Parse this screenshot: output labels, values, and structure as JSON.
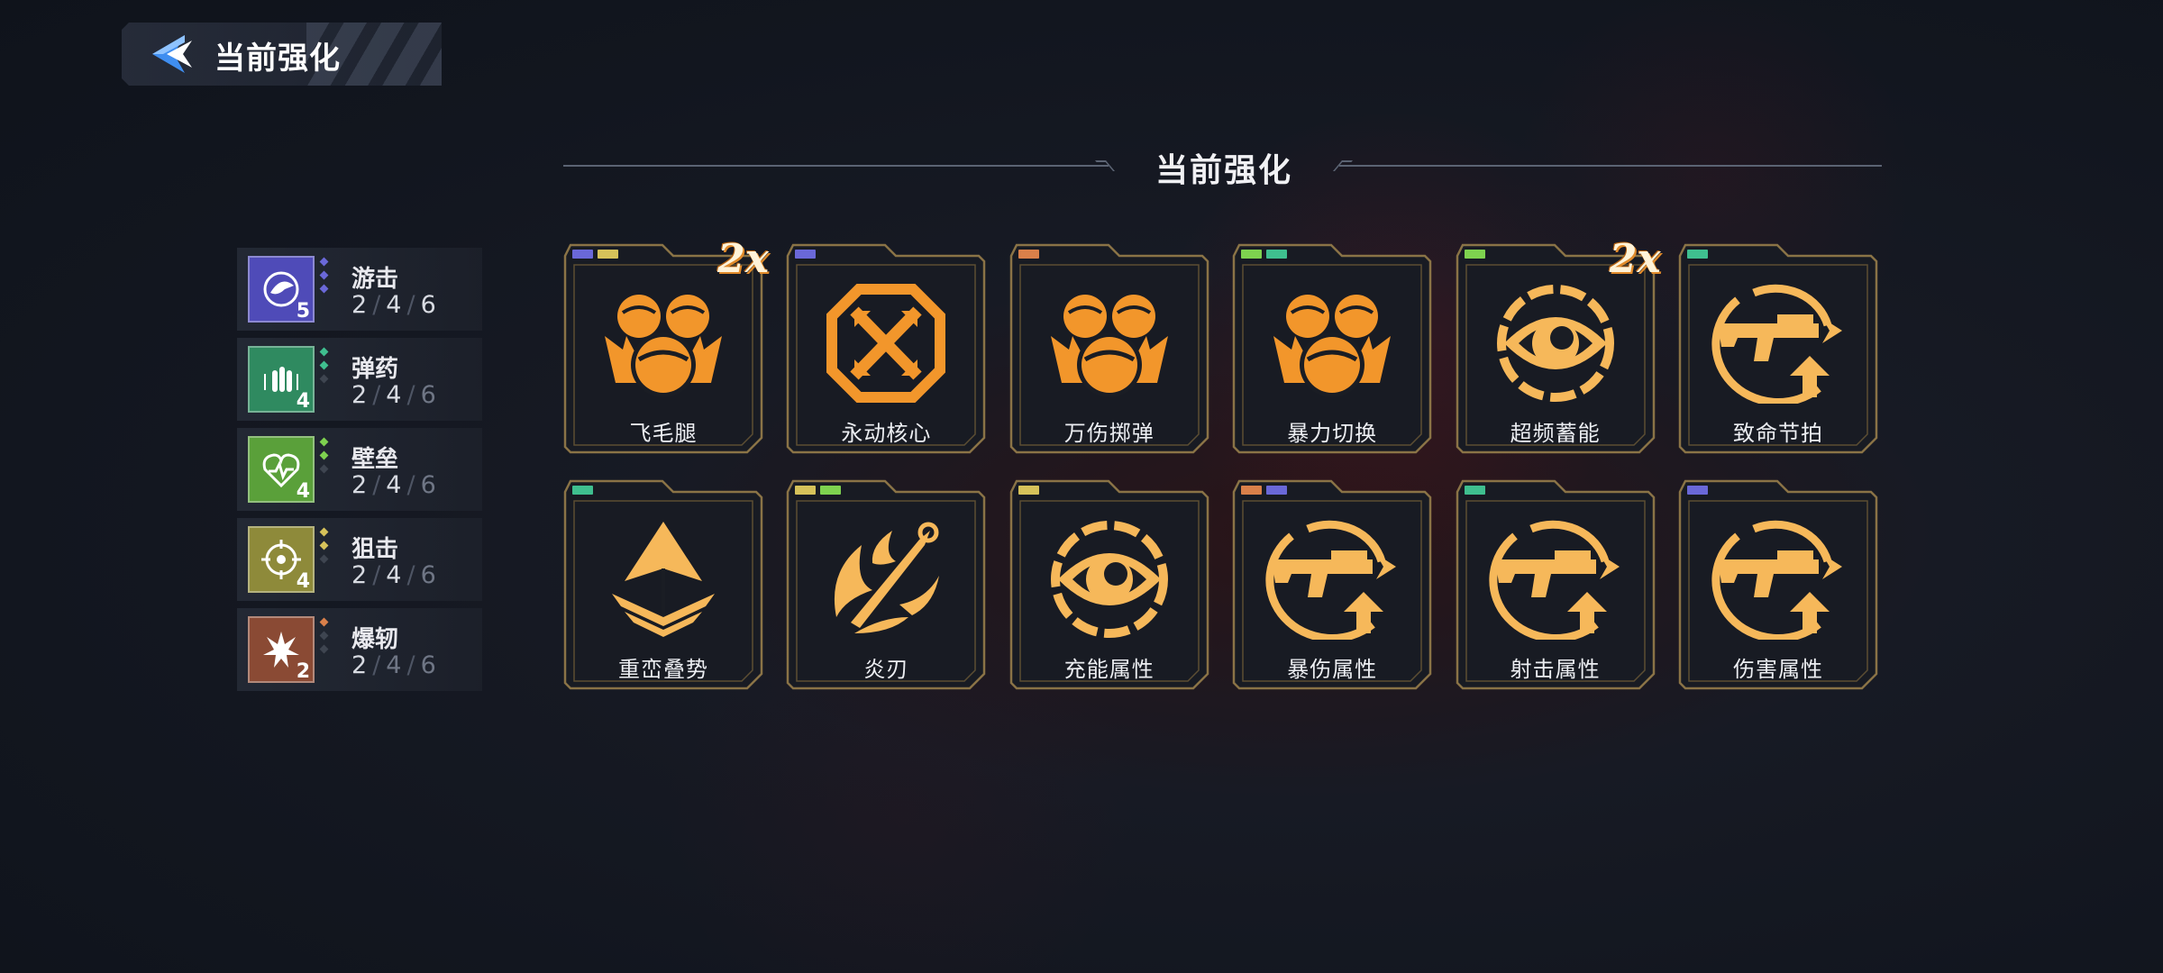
{
  "header": {
    "title": "当前强化"
  },
  "section": {
    "title": "当前强化"
  },
  "colors": {
    "purple": "#6a68d8",
    "yellow": "#d6c25a",
    "orange": "#d9804a",
    "green": "#7ed24f",
    "teal": "#3fbf8f",
    "icon_orange": "#f2962b",
    "icon_gold": "#f6b85a"
  },
  "synergies": [
    {
      "name": "游击",
      "count": "5",
      "tiers": [
        "2",
        "4",
        "6"
      ],
      "active_tiers": 3,
      "color": "#4f4bb8",
      "dot": "#6a68d8",
      "icon": "guerrilla-icon"
    },
    {
      "name": "弹药",
      "count": "4",
      "tiers": [
        "2",
        "4",
        "6"
      ],
      "active_tiers": 2,
      "color": "#2f8a60",
      "dot": "#3fbf8f",
      "icon": "ammo-icon"
    },
    {
      "name": "壁垒",
      "count": "4",
      "tiers": [
        "2",
        "4",
        "6"
      ],
      "active_tiers": 2,
      "color": "#5aa03a",
      "dot": "#7ed24f",
      "icon": "bulwark-icon"
    },
    {
      "name": "狙击",
      "count": "4",
      "tiers": [
        "2",
        "4",
        "6"
      ],
      "active_tiers": 2,
      "color": "#8e8a3a",
      "dot": "#d6c25a",
      "icon": "sniper-icon"
    },
    {
      "name": "爆轫",
      "count": "2",
      "tiers": [
        "2",
        "4",
        "6"
      ],
      "active_tiers": 1,
      "color": "#8a4a34",
      "dot": "#d9804a",
      "icon": "burst-icon"
    }
  ],
  "cards": [
    {
      "name": "飞毛腿",
      "tags": [
        "#6a68d8",
        "#d6c25a"
      ],
      "icon": "dual-orb-icon",
      "icon_color": "#f2962b",
      "badge": "2x"
    },
    {
      "name": "永动核心",
      "tags": [
        "#6a68d8"
      ],
      "icon": "core-cross-icon",
      "icon_color": "#f2962b",
      "badge": ""
    },
    {
      "name": "万伤掷弹",
      "tags": [
        "#d9804a"
      ],
      "icon": "dual-orb-icon",
      "icon_color": "#f2962b",
      "badge": ""
    },
    {
      "name": "暴力切换",
      "tags": [
        "#7ed24f",
        "#3fbf8f"
      ],
      "icon": "dual-orb-icon",
      "icon_color": "#f2962b",
      "badge": ""
    },
    {
      "name": "超频蓄能",
      "tags": [
        "#7ed24f"
      ],
      "icon": "eye-gear-icon",
      "icon_color": "#f6b85a",
      "badge": "2x"
    },
    {
      "name": "致命节拍",
      "tags": [
        "#3fbf8f"
      ],
      "icon": "gun-upgrade-icon",
      "icon_color": "#f6b85a",
      "badge": ""
    },
    {
      "name": "重峦叠势",
      "tags": [
        "#3fbf8f"
      ],
      "icon": "arrow-stack-icon",
      "icon_color": "#f6b85a",
      "badge": ""
    },
    {
      "name": "炎刃",
      "tags": [
        "#d6c25a",
        "#7ed24f"
      ],
      "icon": "flame-blade-icon",
      "icon_color": "#f6b85a",
      "badge": ""
    },
    {
      "name": "充能属性",
      "tags": [
        "#d6c25a"
      ],
      "icon": "eye-gear-icon",
      "icon_color": "#f6b85a",
      "badge": ""
    },
    {
      "name": "暴伤属性",
      "tags": [
        "#d9804a",
        "#6a68d8"
      ],
      "icon": "gun-upgrade-icon",
      "icon_color": "#f6b85a",
      "badge": ""
    },
    {
      "name": "射击属性",
      "tags": [
        "#3fbf8f"
      ],
      "icon": "gun-upgrade-icon",
      "icon_color": "#f6b85a",
      "badge": ""
    },
    {
      "name": "伤害属性",
      "tags": [
        "#6a68d8"
      ],
      "icon": "gun-upgrade-icon",
      "icon_color": "#f6b85a",
      "badge": ""
    }
  ]
}
